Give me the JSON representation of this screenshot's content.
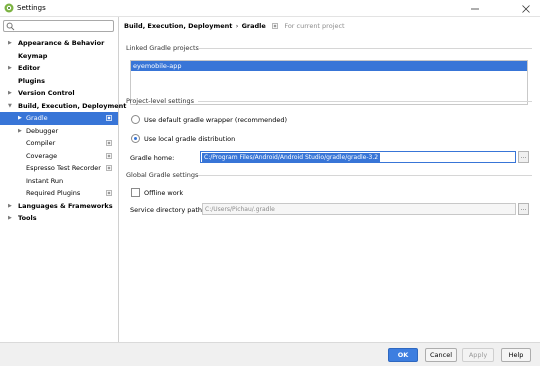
{
  "window": {
    "title": "Settings"
  },
  "search": {
    "placeholder": "",
    "value": ""
  },
  "sidebar": {
    "items": [
      {
        "label": "Appearance & Behavior",
        "level": 0,
        "arrow": "▶"
      },
      {
        "label": "Keymap",
        "level": 0,
        "arrow": ""
      },
      {
        "label": "Editor",
        "level": 0,
        "arrow": "▶"
      },
      {
        "label": "Plugins",
        "level": 0,
        "arrow": ""
      },
      {
        "label": "Version Control",
        "level": 0,
        "arrow": "▶"
      },
      {
        "label": "Build, Execution, Deployment",
        "level": 0,
        "arrow": "▼"
      },
      {
        "label": "Gradle",
        "level": 1,
        "arrow": "▶",
        "selected": true,
        "scope": true
      },
      {
        "label": "Debugger",
        "level": 1,
        "arrow": "▶"
      },
      {
        "label": "Compiler",
        "level": 1,
        "arrow": "",
        "scope": true
      },
      {
        "label": "Coverage",
        "level": 1,
        "arrow": "",
        "scope": true
      },
      {
        "label": "Espresso Test Recorder",
        "level": 1,
        "arrow": "",
        "scope": true
      },
      {
        "label": "Instant Run",
        "level": 1,
        "arrow": ""
      },
      {
        "label": "Required Plugins",
        "level": 1,
        "arrow": "",
        "scope": true
      },
      {
        "label": "Languages & Frameworks",
        "level": 0,
        "arrow": "▶"
      },
      {
        "label": "Tools",
        "level": 0,
        "arrow": "▶"
      }
    ]
  },
  "breadcrumb": {
    "parent": "Build, Execution, Deployment",
    "separator": "›",
    "current": "Gradle",
    "scope_note": "For current project"
  },
  "linked": {
    "title": "Linked Gradle projects",
    "projects": [
      "eyemobile-app"
    ]
  },
  "project_level": {
    "title": "Project-level settings",
    "option_wrapper": "Use default gradle wrapper (recommended)",
    "option_local": "Use local gradle distribution",
    "selected": "local",
    "gradle_home_label": "Gradle home:",
    "gradle_home_value": "C:/Program Files/Android/Android Studio/gradle/gradle-3.2",
    "browse_label": "..."
  },
  "global": {
    "title": "Global Gradle settings",
    "offline_label": "Offline work",
    "offline_checked": false,
    "service_dir_label": "Service directory path:",
    "service_dir_value": "C:/Users/Pichau/.gradle",
    "browse_label": "..."
  },
  "footer": {
    "ok": "OK",
    "cancel": "Cancel",
    "apply": "Apply",
    "help": "Help"
  },
  "colors": {
    "selection": "#3875d7",
    "primary_button": "#3d7ee0"
  },
  "icons": {
    "app": "android-studio-icon",
    "search": "search-icon",
    "scope": "project-scope-icon",
    "minimize": "minimize-icon",
    "close": "close-icon"
  }
}
